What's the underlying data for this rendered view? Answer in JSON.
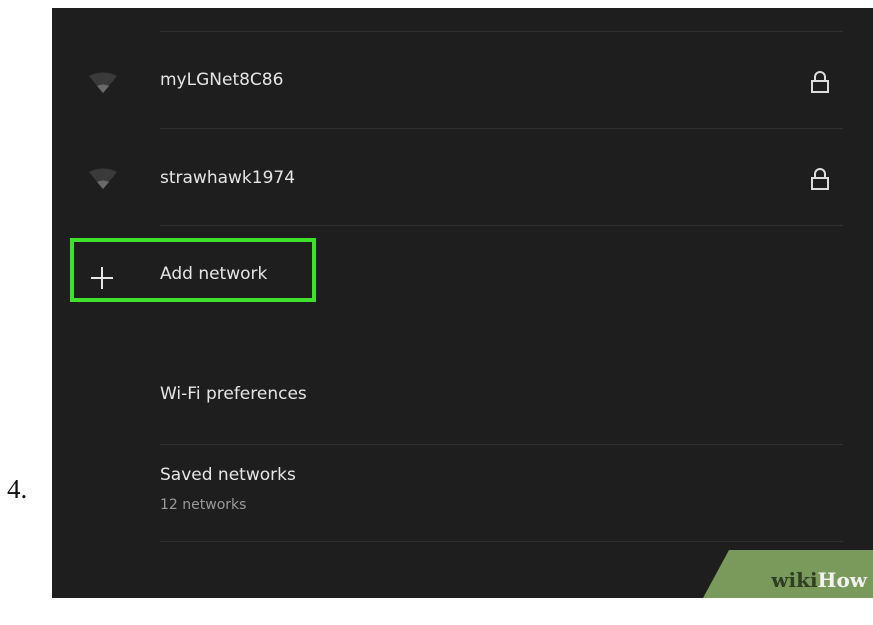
{
  "step": {
    "number": "4."
  },
  "networks": [
    {
      "name": "myLGNet8C86",
      "icon": "wifi-icon",
      "secured": true,
      "lock_icon": "lock-icon"
    },
    {
      "name": "strawhawk1974",
      "icon": "wifi-icon",
      "secured": true,
      "lock_icon": "lock-icon"
    }
  ],
  "add_network": {
    "label": "Add network",
    "icon": "plus-icon"
  },
  "preferences": {
    "wifi_preferences": "Wi-Fi preferences"
  },
  "saved_networks": {
    "label": "Saved networks",
    "count_text": "12 networks"
  },
  "watermark": {
    "part1": "wiki",
    "part2": "How"
  },
  "colors": {
    "background": "#1e1e1e",
    "divider": "#303030",
    "text": "#e6e6e6",
    "subtext": "#9a9a9a",
    "highlight": "#3fe12c",
    "watermark_bg": "#7a9a5c"
  }
}
